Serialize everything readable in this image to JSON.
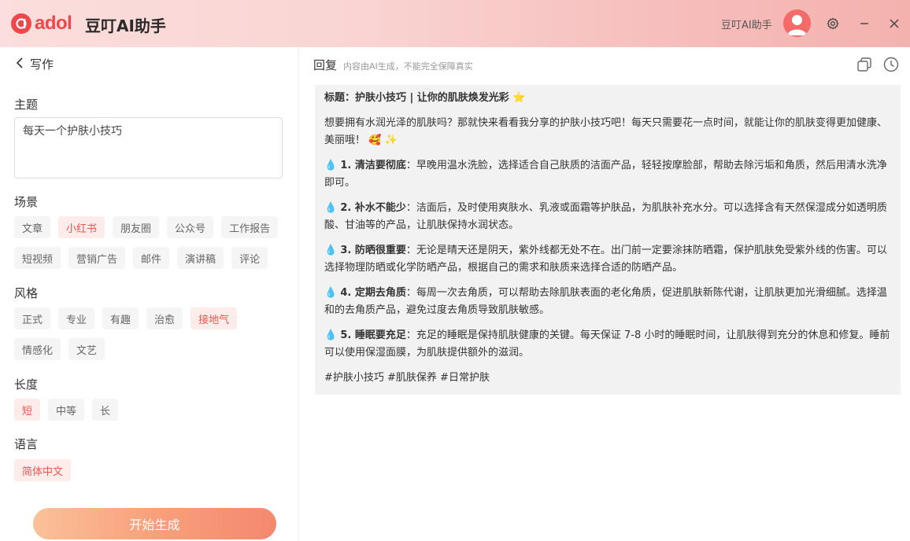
{
  "app": {
    "logo_text": "adol",
    "name": "豆叮AI助手",
    "user_name": "豆叮AI助手",
    "brand_color": "#f0474a"
  },
  "window": {
    "settings_icon": "gear-icon",
    "minimize_icon": "minimize-icon",
    "close_icon": "close-icon"
  },
  "left": {
    "back_label": "写作",
    "topic": {
      "label": "主题",
      "value": "每天一个护肤小技巧"
    },
    "scene": {
      "label": "场景",
      "options": [
        "文章",
        "小红书",
        "朋友圈",
        "公众号",
        "工作报告",
        "短视频",
        "营销广告",
        "邮件",
        "演讲稿",
        "评论"
      ],
      "selected": "小红书"
    },
    "style": {
      "label": "风格",
      "options": [
        "正式",
        "专业",
        "有趣",
        "治愈",
        "接地气",
        "情感化",
        "文艺"
      ],
      "selected": "接地气"
    },
    "length": {
      "label": "长度",
      "options": [
        "短",
        "中等",
        "长"
      ],
      "selected": "短"
    },
    "language": {
      "label": "语言",
      "options": [
        "简体中文"
      ],
      "selected": "简体中文"
    },
    "generate_button": "开始生成"
  },
  "right": {
    "title": "回复",
    "notice": "内容由AI生成，不能完全保障真实",
    "copy_icon": "copy-icon",
    "history_icon": "history-icon",
    "reply": {
      "title": "标题：护肤小技巧 | 让你的肌肤焕发光彩 ⭐",
      "intro": "想要拥有水润光泽的肌肤吗？那就快来看看我分享的护肤小技巧吧！每天只需要花一点时间，就能让你的肌肤变得更加健康、美丽哦！ 🥰 ✨",
      "tips": [
        {
          "heading": "1. 清洁要彻底",
          "text": "：早晚用温水洗脸，选择适合自己肤质的洁面产品，轻轻按摩脸部，帮助去除污垢和角质，然后用清水洗净即可。"
        },
        {
          "heading": "2. 补水不能少",
          "text": "：洁面后，及时使用爽肤水、乳液或面霜等护肤品，为肌肤补充水分。可以选择含有天然保湿成分如透明质酸、甘油等的产品，让肌肤保持水润状态。"
        },
        {
          "heading": "3. 防晒很重要",
          "text": "：无论是晴天还是阴天，紫外线都无处不在。出门前一定要涂抹防晒霜，保护肌肤免受紫外线的伤害。可以选择物理防晒或化学防晒产品，根据自己的需求和肤质来选择合适的防晒产品。"
        },
        {
          "heading": "4. 定期去角质",
          "text": "：每周一次去角质，可以帮助去除肌肤表面的老化角质，促进肌肤新陈代谢，让肌肤更加光滑细腻。选择温和的去角质产品，避免过度去角质导致肌肤敏感。"
        },
        {
          "heading": "5. 睡眠要充足",
          "text": "：充足的睡眠是保持肌肤健康的关键。每天保证 7-8 小时的睡眠时间，让肌肤得到充分的休息和修复。睡前可以使用保湿面膜，为肌肤提供额外的滋润。"
        }
      ],
      "tags": "#护肤小技巧 #肌肤保养 #日常护肤"
    }
  }
}
